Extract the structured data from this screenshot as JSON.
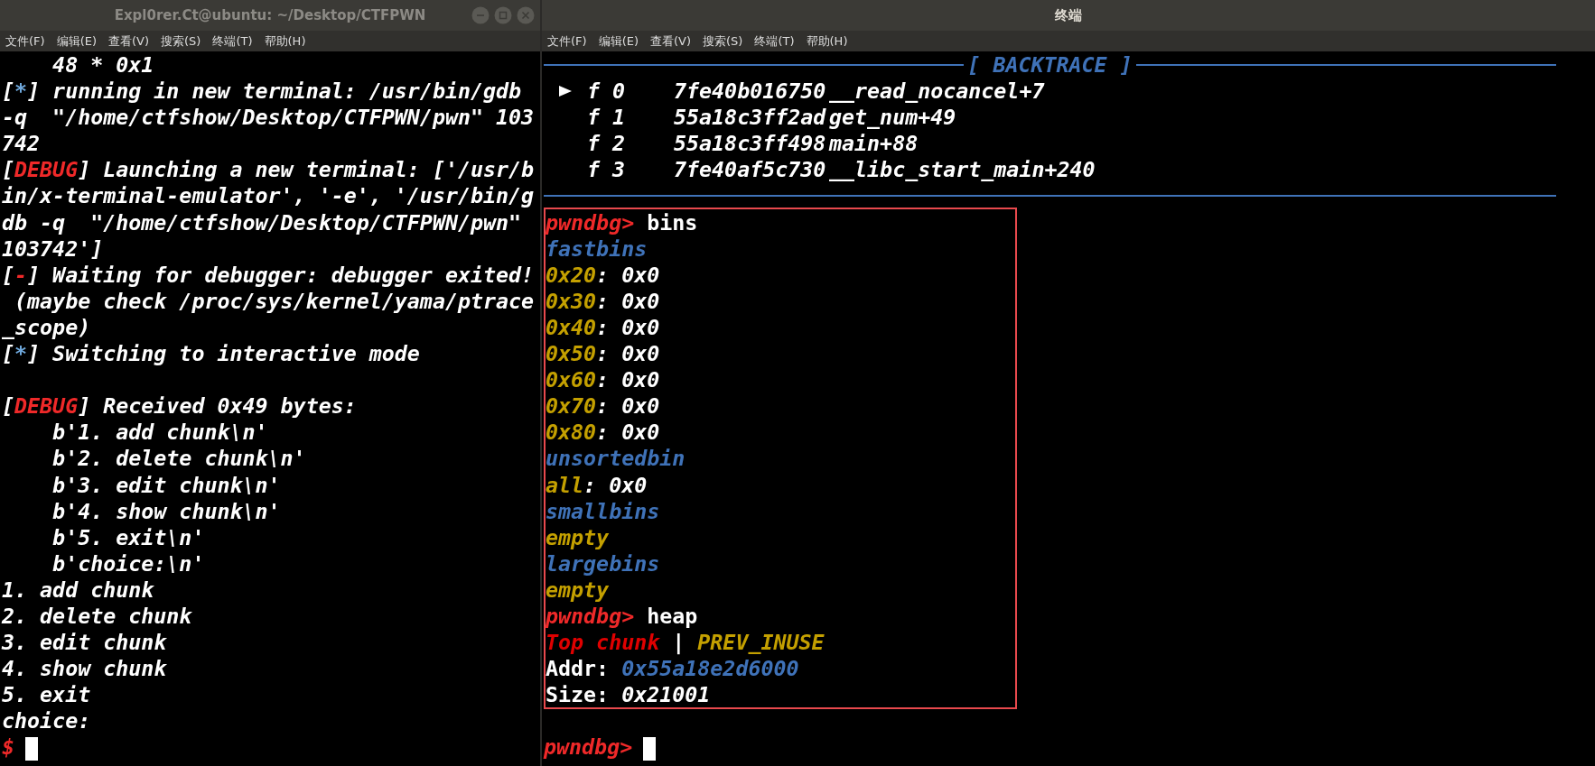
{
  "windows": [
    {
      "title": "Expl0rer.Ct@ubuntu: ~/Desktop/CTFPWN",
      "active": false,
      "window_controls": true,
      "menu": [
        "文件(F)",
        "编辑(E)",
        "查看(V)",
        "搜索(S)",
        "终端(T)",
        "帮助(H)"
      ],
      "output_blocks": [
        [
          [
            {
              "text": "    48 * 0x1"
            }
          ],
          [
            {
              "text": "["
            },
            {
              "text": "*",
              "color": "#6fa8dc"
            },
            {
              "text": "] running in new terminal: /usr/bin/gdb"
            }
          ],
          [
            {
              "text": "-q  \"/home/ctfshow/Desktop/CTFPWN/pwn\" 103"
            }
          ],
          [
            {
              "text": "742"
            }
          ],
          [
            {
              "text": "["
            },
            {
              "text": "DEBUG",
              "color": "#ef2929"
            },
            {
              "text": "] Launching a new terminal: ['/usr/b"
            }
          ],
          [
            {
              "text": "in/x-terminal-emulator', '-e', '/usr/bin/g"
            }
          ],
          [
            {
              "text": "db -q  \"/home/ctfshow/Desktop/CTFPWN/pwn\""
            }
          ],
          [
            {
              "text": "103742']"
            }
          ],
          [
            {
              "text": "["
            },
            {
              "text": "-",
              "color": "#ef2929"
            },
            {
              "text": "] Waiting for debugger: debugger exited!"
            }
          ],
          [
            {
              "text": " (maybe check /proc/sys/kernel/yama/ptrace"
            }
          ],
          [
            {
              "text": "_scope)"
            }
          ],
          [
            {
              "text": "["
            },
            {
              "text": "*",
              "color": "#6fa8dc"
            },
            {
              "text": "] Switching to interactive mode"
            }
          ]
        ],
        [
          [
            {
              "text": "["
            },
            {
              "text": "DEBUG",
              "color": "#ef2929"
            },
            {
              "text": "] Received 0x49 bytes:"
            }
          ],
          [
            {
              "text": "    b'1. add chunk\\n'"
            }
          ],
          [
            {
              "text": "    b'2. delete chunk\\n'"
            }
          ],
          [
            {
              "text": "    b'3. edit chunk\\n'"
            }
          ],
          [
            {
              "text": "    b'4. show chunk\\n'"
            }
          ],
          [
            {
              "text": "    b'5. exit\\n'"
            }
          ],
          [
            {
              "text": "    b'choice:\\n'"
            }
          ],
          [
            {
              "text": "1. add chunk"
            }
          ],
          [
            {
              "text": "2. delete chunk"
            }
          ],
          [
            {
              "text": "3. edit chunk"
            }
          ],
          [
            {
              "text": "4. show chunk"
            }
          ],
          [
            {
              "text": "5. exit"
            }
          ],
          [
            {
              "text": "choice:"
            }
          ]
        ]
      ],
      "prompt": [
        {
          "text": "$",
          "color": "#ef2929"
        }
      ]
    },
    {
      "title": "终端",
      "active": true,
      "window_controls": false,
      "menu": [
        "文件(F)",
        "编辑(E)",
        "查看(V)",
        "搜索(S)",
        "终端(T)",
        "帮助(H)"
      ],
      "backtrace": {
        "title": "[ BACKTRACE ]",
        "frames": [
          {
            "selected": true,
            "frame": "f 0",
            "address": "7fe40b016750",
            "symbol": "__read_nocancel+7"
          },
          {
            "selected": false,
            "frame": "f 1",
            "address": "55a18c3ff2ad",
            "symbol": "get_num+49"
          },
          {
            "selected": false,
            "frame": "f 2",
            "address": "55a18c3ff498",
            "symbol": "main+88"
          },
          {
            "selected": false,
            "frame": "f 3",
            "address": "7fe40af5c730",
            "symbol": "__libc_start_main+240"
          }
        ]
      },
      "highlighted_output": [
        [
          {
            "text": "pwndbg>",
            "color": "#ef2929"
          },
          {
            "text": " bins",
            "upright": true
          }
        ],
        [
          {
            "text": "fastbins",
            "color": "#3f72b8"
          }
        ],
        [
          {
            "text": "0x20",
            "color": "#c4a000"
          },
          {
            "text": ": 0x0"
          }
        ],
        [
          {
            "text": "0x30",
            "color": "#c4a000"
          },
          {
            "text": ": 0x0"
          }
        ],
        [
          {
            "text": "0x40",
            "color": "#c4a000"
          },
          {
            "text": ": 0x0"
          }
        ],
        [
          {
            "text": "0x50",
            "color": "#c4a000"
          },
          {
            "text": ": 0x0"
          }
        ],
        [
          {
            "text": "0x60",
            "color": "#c4a000"
          },
          {
            "text": ": 0x0"
          }
        ],
        [
          {
            "text": "0x70",
            "color": "#c4a000"
          },
          {
            "text": ": 0x0"
          }
        ],
        [
          {
            "text": "0x80",
            "color": "#c4a000"
          },
          {
            "text": ": 0x0"
          }
        ],
        [
          {
            "text": "unsortedbin",
            "color": "#3f72b8"
          }
        ],
        [
          {
            "text": "all",
            "color": "#c4a000"
          },
          {
            "text": ": 0x0"
          }
        ],
        [
          {
            "text": "smallbins",
            "color": "#3f72b8"
          }
        ],
        [
          {
            "text": "empty",
            "color": "#c4a000"
          }
        ],
        [
          {
            "text": "largebins",
            "color": "#3f72b8"
          }
        ],
        [
          {
            "text": "empty",
            "color": "#c4a000"
          }
        ],
        [
          {
            "text": "pwndbg>",
            "color": "#ef2929"
          },
          {
            "text": " heap",
            "upright": true
          }
        ],
        [
          {
            "text": "Top chunk",
            "color": "#e00000"
          },
          {
            "text": " | "
          },
          {
            "text": "PREV_INUSE",
            "color": "#c4a000"
          }
        ],
        [
          {
            "text": "Addr: ",
            "upright": true
          },
          {
            "text": "0x55a18e2d6000",
            "color": "#3f72b8"
          }
        ],
        [
          {
            "text": "Size: ",
            "upright": true
          },
          {
            "text": "0x21001"
          }
        ]
      ],
      "prompt": [
        {
          "text": "pwndbg>",
          "color": "#ef2929"
        }
      ]
    }
  ]
}
